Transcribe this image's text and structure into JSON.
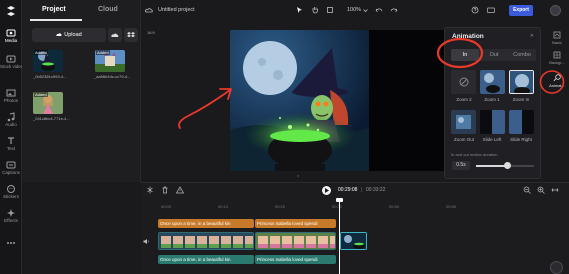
{
  "rail": {
    "items": [
      {
        "label": "Media"
      },
      {
        "label": "Stock videos"
      },
      {
        "label": "Photos"
      },
      {
        "label": "Audio"
      },
      {
        "label": "Text"
      },
      {
        "label": "Captions"
      },
      {
        "label": "Stickers"
      },
      {
        "label": "Effects"
      }
    ]
  },
  "media": {
    "tab_project": "Project",
    "tab_cloud": "Cloud",
    "upload_label": "Upload",
    "thumbs": [
      {
        "badge": "Added",
        "caption": "_0b5238f-c993-4..."
      },
      {
        "badge": "Added",
        "caption": "_aa96b44c-cc79-4..."
      },
      {
        "badge": "Added",
        "caption": "_041c8bc4-771e-4..."
      }
    ]
  },
  "topbar": {
    "project_title": "Untitled project",
    "zoom": "100%",
    "export_label": "Export"
  },
  "canvas": {
    "ratio": "16:9"
  },
  "animation": {
    "title": "Animation",
    "tabs": [
      "In",
      "Out",
      "Combo"
    ],
    "items": [
      {
        "label": ""
      },
      {
        "label": "Zoom 1"
      },
      {
        "label": "Zoom 2"
      },
      {
        "label": "Zoom In"
      },
      {
        "label": "Zoom Out"
      },
      {
        "label": "Slide Left"
      },
      {
        "label": "Slide Right"
      }
    ],
    "duration_label": "In and out motion duration",
    "duration_value": "0.5s",
    "duration_fraction": 0.55
  },
  "rrail": {
    "items": [
      {
        "label": "Basic"
      },
      {
        "label": "Backgr..."
      },
      {
        "label": "Animat..."
      }
    ]
  },
  "timeline": {
    "current_time": "00:29:08",
    "separator": "|",
    "total_time": "00:33:22",
    "ruler": [
      "00:00",
      "00:10",
      "00:20",
      "00:30",
      "00:40",
      "00:50"
    ],
    "text_clips": [
      "Once upon a time, in a beautiful kin",
      "Princess Isabella loved spendi"
    ],
    "voice_clips": [
      "Once upon a time, in a beautiful kin",
      "Princess Isabella loved spendi"
    ]
  },
  "colors": {
    "accent": "#3b5bdb",
    "text_clip": "#c77a2a",
    "voice_clip": "#2a7a6f",
    "annotation_red": "#e8392a"
  }
}
